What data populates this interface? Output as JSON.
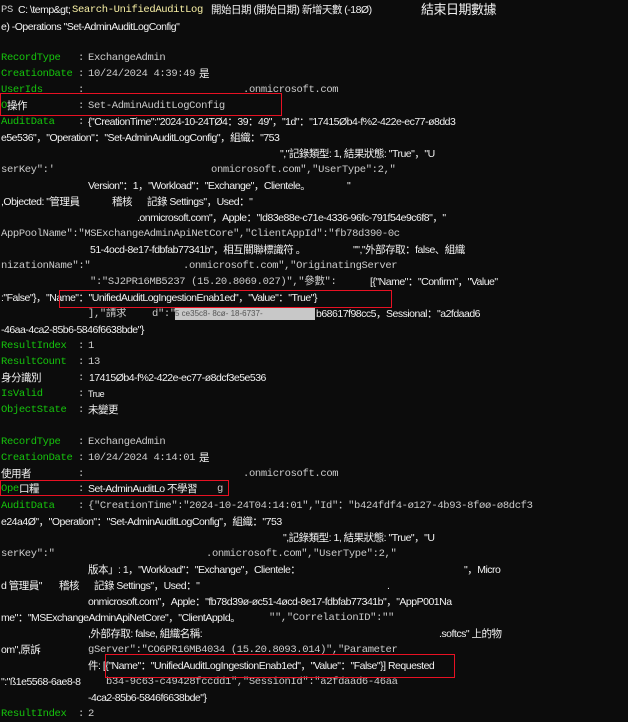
{
  "colors": {
    "background": "#0c0c0c",
    "label": "#16c60c",
    "text": "#cccccc",
    "command": "#f9f1a5",
    "highlight": "#e81123"
  },
  "header": {
    "ps": "PS",
    "path": "C: \\temp&gt;",
    "cmd": "Search-UnifiedAuditLog",
    "arg1": "開始日期 (開始日期) 新增天數 (-18Ø)",
    "arg2": "結束日期數據",
    "line2": "e) -Operations \"Set-AdminAuditLogConfig\""
  },
  "sep": ":",
  "r1": {
    "recordtype_l": "RecordType",
    "recordtype_v": "ExchangeAdmin",
    "cd_l": "CreationDate",
    "cd_v": "10/24/2024 4:39:49",
    "cd_s": "是",
    "uid_l": "UserIds",
    "uid_v": ".onmicrosoft.com",
    "op_l1": "O",
    "op_l2": "操作",
    "op_v": "Set-AdminAuditLogConfig",
    "ad_l": "AuditData",
    "ad_v": "{\"CreationTime\":\"2024-10-24TØ4：39：49\"，\"1d\"：\"17415Øb4-f%2-422e-ec77-ø8dd3",
    "a1": "e5e536\"，\"Operation\"：\"Set-AdminAuditLogConfig\"，組織：\"753",
    "a2": "\",\"記錄類型: 1, 結果狀態: \"True\"，\"U",
    "a3a": "serKey\":'",
    "a3b": "onmicrosoft.com\",\"UserType\":2,\"",
    "a4a": "Version\"：1，\"Workload\"：\"Exchange\"，Clientele。",
    "a4b": "\"",
    "a5a": ",Objected: \"管理員",
    "a5b": "稽核",
    "a5c": "記錄 Settings\"，Used：\"",
    "a6": ".onmicrosoft.com\"，Apple：\"Id83e88e-c71e-4336-96fc-791f54e9c6f8\"，\"",
    "a7": "AppPoolName\":\"MSExchangeAdminApiNetCore\",\"ClientAppId\":\"fb78d390-0c",
    "a8a": "51-4ocd-8e17-fdbfab77341b\"，相互關聯標識符 。",
    "a8b": "\"\",\"外部存取：false、組織",
    "a9a": "nizationName\":\"",
    "a9b": ".onmicrosoft.com\",\"OriginatingServer",
    "a10a": "\":\"SJ2PR16MB5237 (15.20.8069.027)\",\"參數\":",
    "a10b": "[{\"Name\"：\"Confirm\"，\"Value\"",
    "a11": ":\"False\"}，\"Name\"：\"UnifiedAuditLogIngestionEnab1ed\"，\"Value\"：\"True\"}",
    "a12a": "],\"請求",
    "a12b": "d\":\"",
    "a12c": "5 ce35c8- 8cø- 18-6737-",
    "a12d": "b68617f98cc5，Sessional：\"a2fdaad6",
    "a13": "-46aa-4ca2-85b6-5846f6638bde\"}",
    "ri_l": "ResultIndex",
    "ri_v": "1",
    "rc_l": "ResultCount",
    "rc_v": "13",
    "id_l": "身分識別",
    "id_v": "17415Øb4-f%2-422e-ec77-ø8dcf3e5e536",
    "iv_l": "IsValid",
    "iv_v": "True",
    "os_l": "ObjectState",
    "os_v": "未變更"
  },
  "r2": {
    "recordtype_l": "RecordType",
    "recordtype_v": "ExchangeAdmin",
    "cd_l": "CreationDate",
    "cd_v": "10/24/2024 4:14:01",
    "cd_s": "是",
    "uid_l": "使用者",
    "uid_v": ".onmicrosoft.com",
    "op_l1": "Ope",
    "op_l2": "口糧",
    "op_v": "Set-AdminAuditLo 不學習",
    "op_g": "g",
    "ad_l": "AuditData",
    "ad_v": "{\"CreationTime\":\"2024-10-24T04:14:01\",\"Id\"：\"b424fdf4-ø127-4b93-8føø-ø8dcf3",
    "a1": "e24a4Ø\"，\"Operation\"：\"Set-AdminAuditLogConfig\"，組織：\"753",
    "a2": "\",記錄類型: 1, 結果狀態: \"True\"，\"U",
    "a3a": "serKey\":\"",
    "a3b": ".onmicrosoft.com\",\"UserType\":2,\"",
    "a4a": "版本」: 1，\"Workload\"：\"Exchange\"，Clientele：",
    "a4b": "\"，Micro",
    "a5a": "d 管理員\"",
    "a5b": "稽核",
    "a5c": "記錄 Settings\"，Used：\"",
    "a5d": ".",
    "a6": "onmicrosoft.com\"，Apple：\"fb78d39ø-øc51-4øcd-8e17-fdbfab77341b\"，\"AppP001Na",
    "a7a": "me\"：\"MSExchangeAdminApiNetCore\"，\"ClientAppId。",
    "a7b": "\"\",\"CorrelationID\":\"\"",
    "a8a": ",外部存取: false, 組織名稱:",
    "a8b": ".softcs\" 上的物",
    "a9a": "om\",原訴",
    "a9b": "gServer\":\"CO6PR16MB4034 (15.20.8093.014)\",\"Parameter",
    "a10": "件: [{\"Name\"：\"UnifiedAuditLogIngestionEnab1ed\"，\"Value\"：\"False\"}] Requested",
    "a11a": "\":\"ß1e5568-6ae8-8",
    "a11b": "b34-9c63-c49428fccdd1\",\"SessionId\":\"a2fdaad6-46aa",
    "a12": "-4ca2-85b6-5846f6638bde\"}",
    "ri_l": "ResultIndex",
    "ri_v": "2"
  }
}
